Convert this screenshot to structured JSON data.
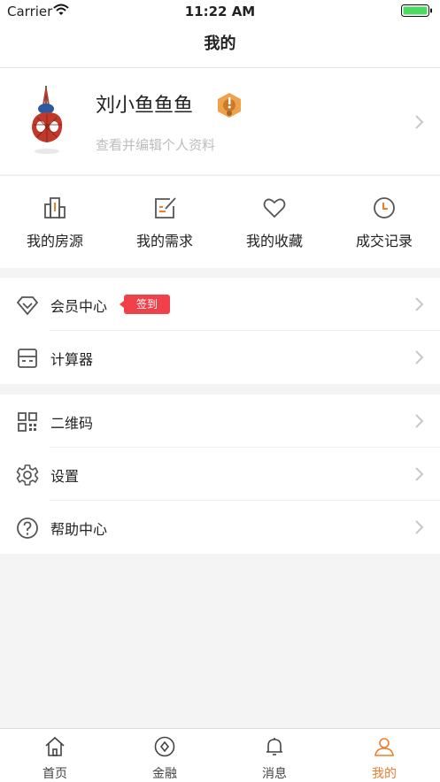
{
  "status_bar": {
    "carrier": "Carrier",
    "time": "11:22 AM"
  },
  "nav": {
    "title": "我的"
  },
  "profile": {
    "name": "刘小鱼鱼鱼",
    "subtitle": "查看并编辑个人资料"
  },
  "quick_actions": [
    {
      "label": "我的房源",
      "icon": "building-icon"
    },
    {
      "label": "我的需求",
      "icon": "edit-note-icon"
    },
    {
      "label": "我的收藏",
      "icon": "heart-icon"
    },
    {
      "label": "成交记录",
      "icon": "clock-icon"
    }
  ],
  "menu_group_1": [
    {
      "label": "会员中心",
      "icon": "diamond-icon",
      "tag": "签到"
    },
    {
      "label": "计算器",
      "icon": "calculator-icon"
    }
  ],
  "menu_group_2": [
    {
      "label": "二维码",
      "icon": "qrcode-icon"
    },
    {
      "label": "设置",
      "icon": "gear-icon"
    },
    {
      "label": "帮助中心",
      "icon": "help-icon"
    }
  ],
  "tab_bar": [
    {
      "label": "首页",
      "icon": "home-icon",
      "active": false
    },
    {
      "label": "金融",
      "icon": "finance-icon",
      "active": false
    },
    {
      "label": "消息",
      "icon": "bell-icon",
      "active": false
    },
    {
      "label": "我的",
      "icon": "user-icon",
      "active": true
    }
  ],
  "colors": {
    "accent": "#f07d2a",
    "tag_red": "#f0414a",
    "icon_gray": "#666666",
    "chevron": "#c7c7c7"
  }
}
